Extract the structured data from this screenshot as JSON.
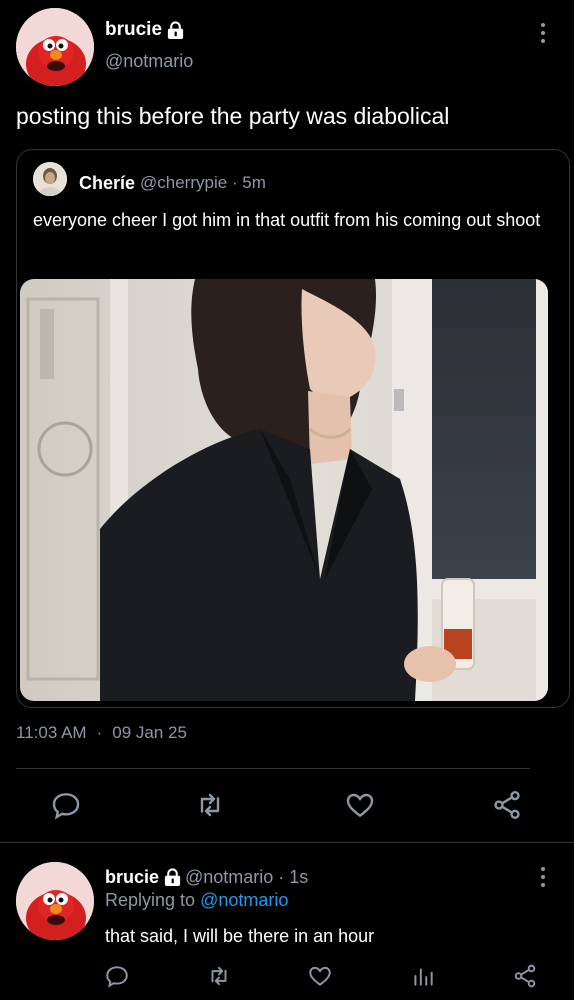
{
  "main_tweet": {
    "author_name": "brucie",
    "author_handle": "@notmario",
    "text": "posting this before the party was diabolical",
    "time": "11:03 AM",
    "separator": "·",
    "date": "09 Jan 25"
  },
  "quoted_tweet": {
    "author_name": "Cheríe",
    "author_handle": "@cherrypie · 5m",
    "text": "everyone cheer I got him in that outfit from his coming out shoot"
  },
  "reply_tweet": {
    "author_name": "brucie",
    "author_handle_time": "@notmario · 1s",
    "replying_prefix": "Replying to",
    "replying_to": "@notmario",
    "text": "that said, I will be there in an hour"
  },
  "icons": {
    "lock": "lock-icon",
    "more": "more-options-icon",
    "reply": "reply-icon",
    "retweet": "retweet-icon",
    "like": "heart-icon",
    "share": "share-icon",
    "analytics": "analytics-icon"
  },
  "colors": {
    "background": "#000000",
    "text": "#ffffff",
    "secondary": "#8b98a5",
    "link": "#1d9bf0",
    "border": "#2f3336"
  }
}
